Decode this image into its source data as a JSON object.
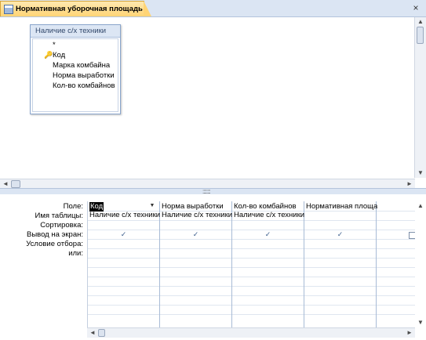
{
  "window": {
    "title": "Нормативная уборочная площадь",
    "close_glyph": "×"
  },
  "table_box": {
    "title": "Наличие с/х техники",
    "fields": [
      "*",
      "Код",
      "Марка комбайна",
      "Норма выработки",
      "Кол-во комбайнов"
    ],
    "key_field_index": 1
  },
  "grid": {
    "row_labels": [
      "Поле:",
      "Имя таблицы:",
      "Сортировка:",
      "Вывод на экран:",
      "Условие отбора:",
      "или:"
    ],
    "columns": [
      {
        "field": "Код",
        "table": "Наличие с/х техники",
        "show": true
      },
      {
        "field": "Норма выработки",
        "table": "Наличие с/х техники",
        "show": true
      },
      {
        "field": "Кол-во комбайнов",
        "table": "Наличие с/х техники",
        "show": true
      },
      {
        "field": "Нормативная площа",
        "table": "",
        "show": true
      },
      {
        "field": "",
        "table": "",
        "show": false
      }
    ]
  },
  "scroll": {
    "up": "▲",
    "down": "▼",
    "left": "◄",
    "right": "►"
  },
  "splitter_grip": "::::::::",
  "colors": {
    "tab_bg": "#ffd475",
    "header_bg": "#dbe5f3",
    "table_header": "#dce6f4",
    "check": "#3d5f8d"
  }
}
